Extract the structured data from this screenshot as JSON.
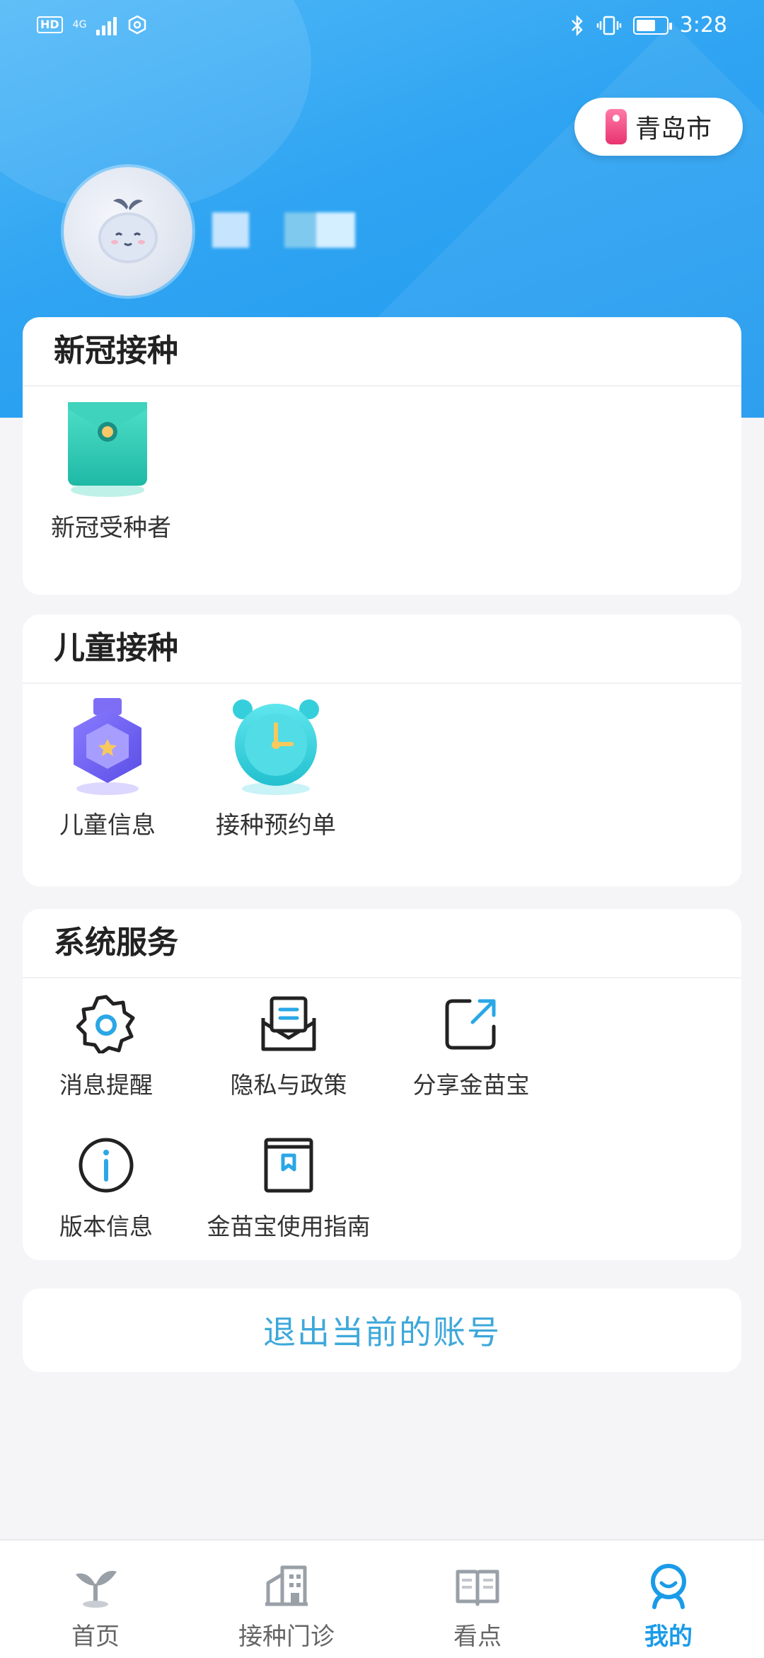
{
  "status_bar": {
    "hd": "HD",
    "network": "4G",
    "time": "3:28"
  },
  "header": {
    "city": "青岛市"
  },
  "sections": {
    "covid": {
      "title": "新冠接种",
      "items": [
        {
          "label": "新冠受种者",
          "icon": "envelope-icon"
        }
      ]
    },
    "child": {
      "title": "儿童接种",
      "items": [
        {
          "label": "儿童信息",
          "icon": "medal-icon"
        },
        {
          "label": "接种预约单",
          "icon": "clock-icon"
        }
      ]
    },
    "system": {
      "title": "系统服务",
      "items": [
        {
          "label": "消息提醒",
          "icon": "gear-icon"
        },
        {
          "label": "隐私与政策",
          "icon": "document-icon"
        },
        {
          "label": "分享金苗宝",
          "icon": "share-icon"
        },
        {
          "label": "版本信息",
          "icon": "info-icon"
        },
        {
          "label": "金苗宝使用指南",
          "icon": "book-icon"
        }
      ]
    }
  },
  "logout": {
    "label": "退出当前的账号"
  },
  "nav": [
    {
      "label": "首页",
      "icon": "sprout-icon"
    },
    {
      "label": "接种门诊",
      "icon": "clinic-icon"
    },
    {
      "label": "看点",
      "icon": "book-open-icon"
    },
    {
      "label": "我的",
      "icon": "profile-icon",
      "active": true
    }
  ],
  "colors": {
    "accent": "#1a9be8",
    "header": "#2fa4f2",
    "logout": "#3ea8da"
  }
}
